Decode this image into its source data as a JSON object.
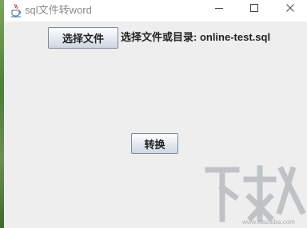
{
  "window": {
    "title": "sql文件转word",
    "icon": "java-cup-icon",
    "controls": [
      "minimize-icon",
      "maximize-icon",
      "close-icon"
    ]
  },
  "main": {
    "choose_button_label": "选择文件",
    "path_text": "选择文件或目录: online-test.sql",
    "convert_button_label": "转换"
  },
  "watermark": {
    "url": "www.xiazaiba.com"
  },
  "colors": {
    "background": "#eeeeee",
    "button_border": "#7a8a99",
    "title_text": "#8a8a8a"
  }
}
